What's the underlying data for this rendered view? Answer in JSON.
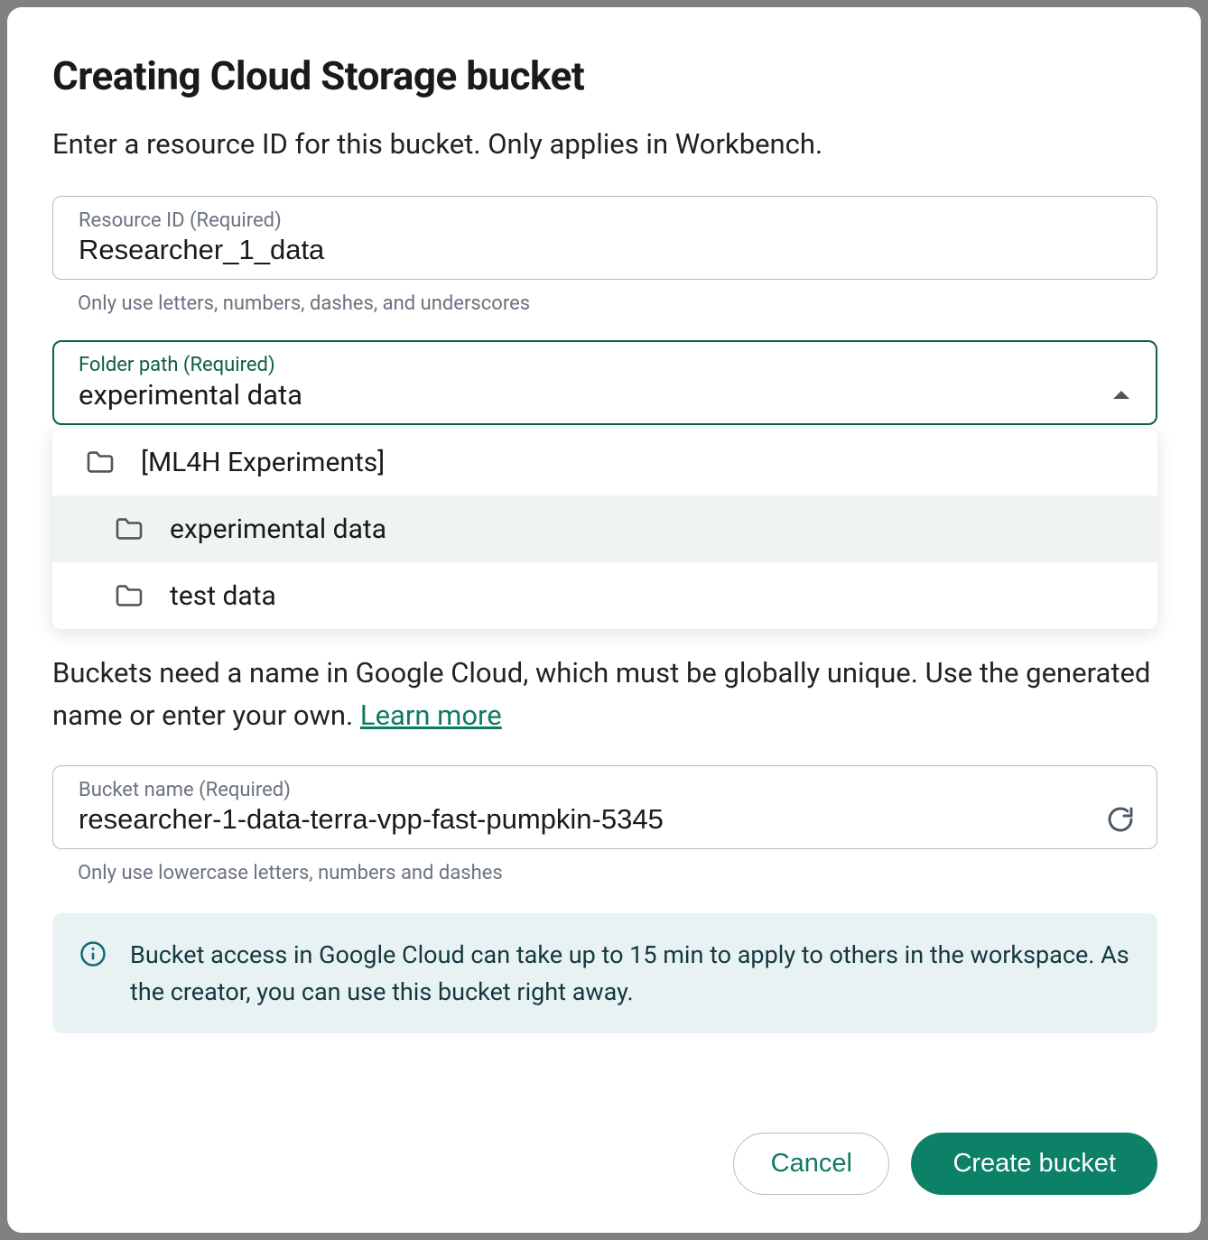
{
  "dialog": {
    "title": "Creating Cloud Storage bucket",
    "subtitle": "Enter a resource ID for this bucket. Only applies in Workbench."
  },
  "resource_id": {
    "label": "Resource ID (Required)",
    "value": "Researcher_1_data",
    "help": "Only use letters, numbers, dashes, and underscores"
  },
  "folder_path": {
    "label": "Folder path (Required)",
    "value": "experimental data",
    "options": [
      {
        "label": "[ML4H Experiments]",
        "indent": 0,
        "selected": false
      },
      {
        "label": "experimental data",
        "indent": 1,
        "selected": true
      },
      {
        "label": "test data",
        "indent": 1,
        "selected": false
      }
    ]
  },
  "bucket_name": {
    "description_prefix": "Buckets need a name in Google Cloud, which must be globally unique. Use the generated name or enter your own. ",
    "learn_more": "Learn more",
    "label": "Bucket name (Required)",
    "value": "researcher-1-data-terra-vpp-fast-pumpkin-5345",
    "help": "Only use lowercase letters, numbers and dashes"
  },
  "alert": {
    "text": "Bucket access in Google Cloud can take up to 15 min to apply to others in the workspace. As the creator, you can use this bucket right away."
  },
  "actions": {
    "cancel": "Cancel",
    "create": "Create bucket"
  },
  "colors": {
    "accent": "#0d8068",
    "focus_border": "#0d5d4a",
    "alert_bg": "#e9f2f3"
  }
}
